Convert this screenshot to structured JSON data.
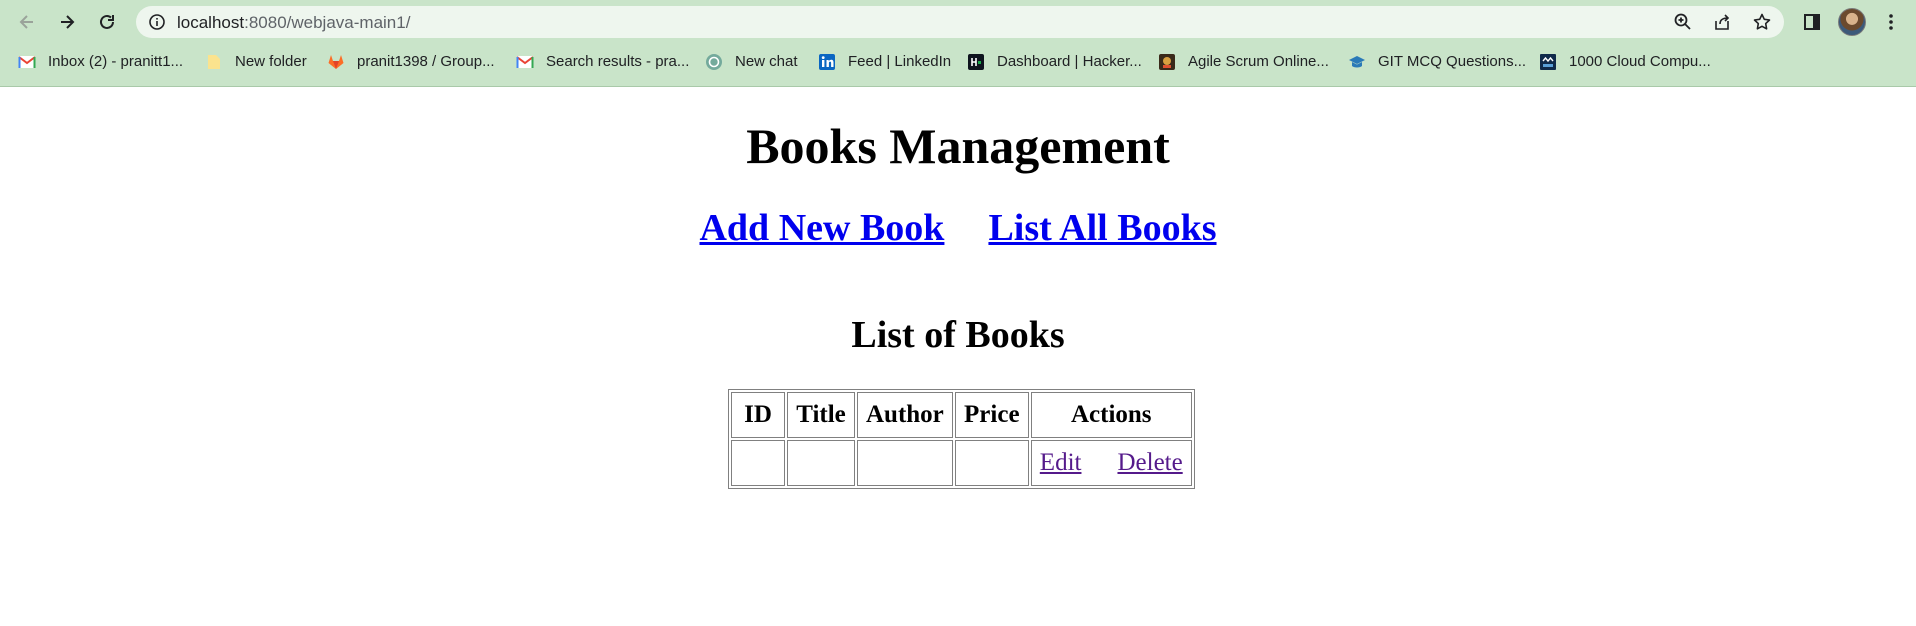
{
  "browser": {
    "url_host": "localhost",
    "url_path": ":8080/webjava-main1/",
    "bookmarks": [
      {
        "label": "Inbox (2) - pranitt1...",
        "icon": "gmail-icon"
      },
      {
        "label": "New folder",
        "icon": "folder-icon"
      },
      {
        "label": "pranit1398 / Group...",
        "icon": "gitlab-icon"
      },
      {
        "label": "Search results - pra...",
        "icon": "gmail-icon"
      },
      {
        "label": "New chat",
        "icon": "chatgpt-icon"
      },
      {
        "label": "Feed | LinkedIn",
        "icon": "linkedin-icon"
      },
      {
        "label": "Dashboard | Hacker...",
        "icon": "hackerrank-icon"
      },
      {
        "label": "Agile Scrum Online...",
        "icon": "scrum-icon"
      },
      {
        "label": "GIT MCQ Questions...",
        "icon": "mcq-icon"
      },
      {
        "label": "1000 Cloud Compu...",
        "icon": "sanfoundry-icon"
      }
    ]
  },
  "page": {
    "title": "Books Management",
    "nav": {
      "add_label": "Add New Book",
      "list_label": "List All Books"
    },
    "list_title": "List of Books",
    "table": {
      "headers": [
        "ID",
        "Title",
        "Author",
        "Price",
        "Actions"
      ],
      "rows": [
        {
          "id": "",
          "title": "",
          "author": "",
          "price": "",
          "edit_label": "Edit",
          "delete_label": "Delete"
        }
      ]
    }
  },
  "colors": {
    "chrome_bg": "#c9e4c9",
    "link": "#0000ee",
    "visited_link": "#551a8b"
  }
}
